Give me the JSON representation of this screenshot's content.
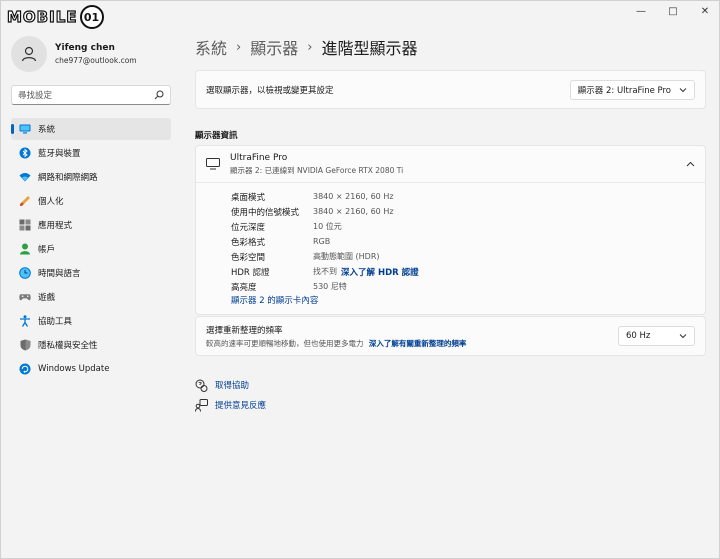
{
  "title_bar": {
    "logo_text": "MOBILE",
    "logo_badge": "01",
    "controls": [
      "—",
      "□",
      "✕"
    ]
  },
  "profile": {
    "name": "Yifeng chen",
    "email": "che977@outlook.com"
  },
  "search": {
    "placeholder": "尋找設定"
  },
  "sidebar": {
    "items": [
      {
        "label": "系統",
        "icon": "monitor-icon",
        "active": true
      },
      {
        "label": "藍牙與裝置",
        "icon": "bluetooth-icon",
        "active": false
      },
      {
        "label": "網路和網際網路",
        "icon": "wifi-icon",
        "active": false
      },
      {
        "label": "個人化",
        "icon": "brush-icon",
        "active": false
      },
      {
        "label": "應用程式",
        "icon": "apps-icon",
        "active": false
      },
      {
        "label": "帳戶",
        "icon": "person-icon",
        "active": false
      },
      {
        "label": "時間與語言",
        "icon": "globe-clock-icon",
        "active": false
      },
      {
        "label": "遊戲",
        "icon": "gamepad-icon",
        "active": false
      },
      {
        "label": "協助工具",
        "icon": "accessibility-icon",
        "active": false
      },
      {
        "label": "隱私權與安全性",
        "icon": "shield-icon",
        "active": false
      },
      {
        "label": "Windows Update",
        "icon": "update-icon",
        "active": false
      }
    ]
  },
  "breadcrumb": {
    "items": [
      "系統",
      "顯示器",
      "進階型顯示器"
    ],
    "separator": "›"
  },
  "display_select": {
    "label": "選取顯示器，以檢視或變更其設定",
    "value": "顯示器 2: UltraFine Pro"
  },
  "section_title": "顯示器資訊",
  "display_info": {
    "name": "UltraFine Pro",
    "subtitle": "顯示器 2: 已連線到 NVIDIA GeForce RTX 2080 Ti",
    "rows": [
      {
        "key": "桌面模式",
        "value": "3840 × 2160, 60 Hz"
      },
      {
        "key": "使用中的信號模式",
        "value": "3840 × 2160, 60 Hz"
      },
      {
        "key": "位元深度",
        "value": "10 位元"
      },
      {
        "key": "色彩格式",
        "value": "RGB"
      },
      {
        "key": "色彩空間",
        "value": "高動態範圍 (HDR)"
      },
      {
        "key": "HDR 認證",
        "value": "找不到",
        "link": "深入了解 HDR 認證"
      },
      {
        "key": "高亮度",
        "value": "530 尼特"
      }
    ],
    "adapter_link": "顯示器 2 的顯示卡內容"
  },
  "refresh": {
    "title": "選擇重新整理的頻率",
    "description": "較高的速率可更順暢地移動，但也使用更多電力",
    "link": "深入了解有關重新整理的頻率",
    "value": "60 Hz"
  },
  "help": {
    "get_help": "取得協助",
    "feedback": "提供意見反應"
  },
  "colors": {
    "accent": "#0067c0",
    "link": "#003e92",
    "background": "#f3f3f3",
    "card": "#fbfbfb"
  }
}
